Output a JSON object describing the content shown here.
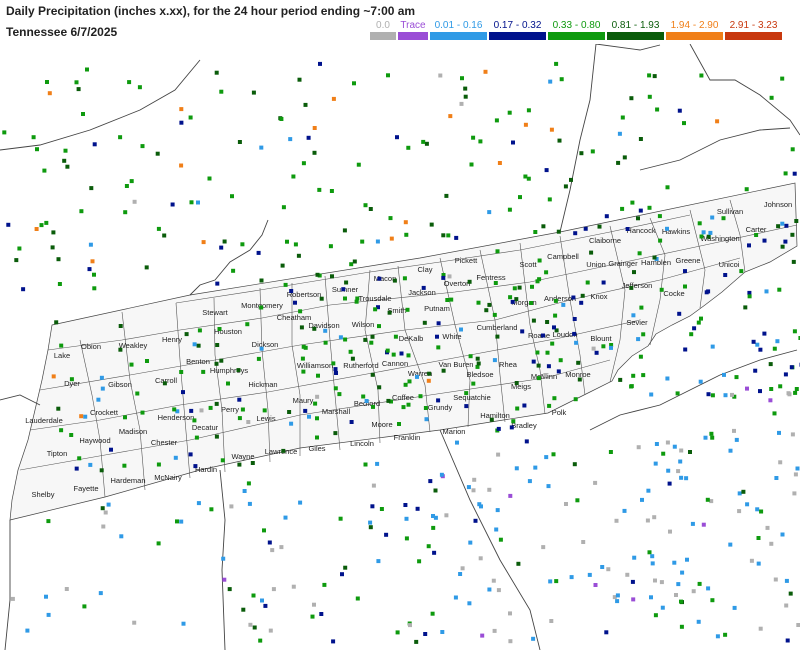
{
  "title": {
    "line1": "Daily Precipitation (inches  x.xx),  for the 24 hour period ending ~7:00 am",
    "line2": "Tennessee 6/7/2025"
  },
  "legend": [
    {
      "label": "0.0",
      "color": "#b0b0b0"
    },
    {
      "label": "Trace",
      "color": "#9a4dd6"
    },
    {
      "label": "0.01 - 0.16",
      "color": "#2f9ae6"
    },
    {
      "label": "0.17 - 0.32",
      "color": "#00128c"
    },
    {
      "label": "0.33 - 0.80",
      "color": "#0e9a0e"
    },
    {
      "label": "0.81 - 1.93",
      "color": "#0a5c0a"
    },
    {
      "label": "1.94 - 2.90",
      "color": "#f07f18"
    },
    {
      "label": "2.91 - 3.23",
      "color": "#c8380e"
    }
  ],
  "counties": [
    "Sullivan",
    "Johnson",
    "Carter",
    "Hancock",
    "Hawkins",
    "Washington",
    "Claiborne",
    "Unicoi",
    "Grainger",
    "Hamblen",
    "Greene",
    "Campbell",
    "Union",
    "Scott",
    "Jefferson",
    "Cocke",
    "Knox",
    "Sevier",
    "Blount",
    "Anderson",
    "Morgan",
    "Roane",
    "Loudon",
    "Monroe",
    "McMinn",
    "Polk",
    "Bradley",
    "Meigs",
    "Rhea",
    "Hamilton",
    "Clay",
    "Pickett",
    "Fentress",
    "Overton",
    "Jackson",
    "Macon",
    "Trousdale",
    "Smith",
    "Putnam",
    "Cumberland",
    "DeKalb",
    "White",
    "Van Buren",
    "Warren",
    "Bledsoe",
    "Sequatchie",
    "Grundy",
    "Marion",
    "Franklin",
    "Coffee",
    "Cannon",
    "Rutherford",
    "Wilson",
    "Sumner",
    "Davidson",
    "Robertson",
    "Montgomery",
    "Stewart",
    "Houston",
    "Dickson",
    "Cheatham",
    "Williamson",
    "Maury",
    "Marshall",
    "Bedford",
    "Moore",
    "Lincoln",
    "Giles",
    "Lawrence",
    "Wayne",
    "Hickman",
    "Lewis",
    "Perry",
    "Humphreys",
    "Benton",
    "Henry",
    "Weakley",
    "Obion",
    "Lake",
    "Dyer",
    "Gibson",
    "Carroll",
    "Decatur",
    "Henderson",
    "Madison",
    "Crockett",
    "Lauderdale",
    "Haywood",
    "Chester",
    "Hardin",
    "McNairy",
    "Hardeman",
    "Tipton",
    "Fayette",
    "Shelby"
  ]
}
